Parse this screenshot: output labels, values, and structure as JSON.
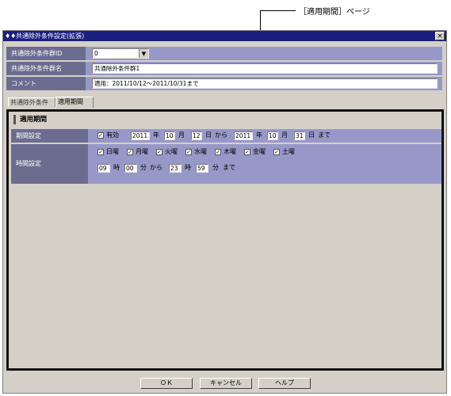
{
  "callout": {
    "label": "［適用期間］ページ"
  },
  "window": {
    "title": "共通除外条件設定(拡張)",
    "close_symbol": "✕",
    "app_icon": "app-icon"
  },
  "fields": {
    "group_id_label": "共通除外条件群ID",
    "group_id_value": "0",
    "group_name_label": "共通除外条件群名",
    "group_name_value": "共通除外条件群1",
    "comment_label": "コメント",
    "comment_value": "適用：2011/10/12～2011/10/31まで"
  },
  "tabs": [
    {
      "label": "共通除外条件"
    },
    {
      "label": "適用期間"
    }
  ],
  "period_page": {
    "title": "適用期間",
    "period_label": "期間設定",
    "enabled_label": "有効",
    "from_year": "2011",
    "year_unit": "年",
    "from_month": "10",
    "month_unit": "月",
    "from_day": "12",
    "day_unit": "日",
    "from_word": "から",
    "to_year": "2011",
    "to_month": "10",
    "to_day": "31",
    "until_word": "まで",
    "time_label": "時間設定",
    "weekdays": [
      "日曜",
      "月曜",
      "火曜",
      "水曜",
      "木曜",
      "金曜",
      "土曜"
    ],
    "from_hour": "09",
    "hour_unit": "時",
    "from_minute": "00",
    "minute_unit": "分",
    "to_hour": "23",
    "to_minute": "59",
    "check_mark": "✓"
  },
  "buttons": {
    "ok": "ＯＫ",
    "cancel": "キャンセル",
    "help": "ヘルプ"
  },
  "colors": {
    "titlebar": "#1a1f80",
    "label_bg": "#6c6c8e",
    "value_bg": "#9898c8",
    "dialog_bg": "#d4d0c8"
  }
}
